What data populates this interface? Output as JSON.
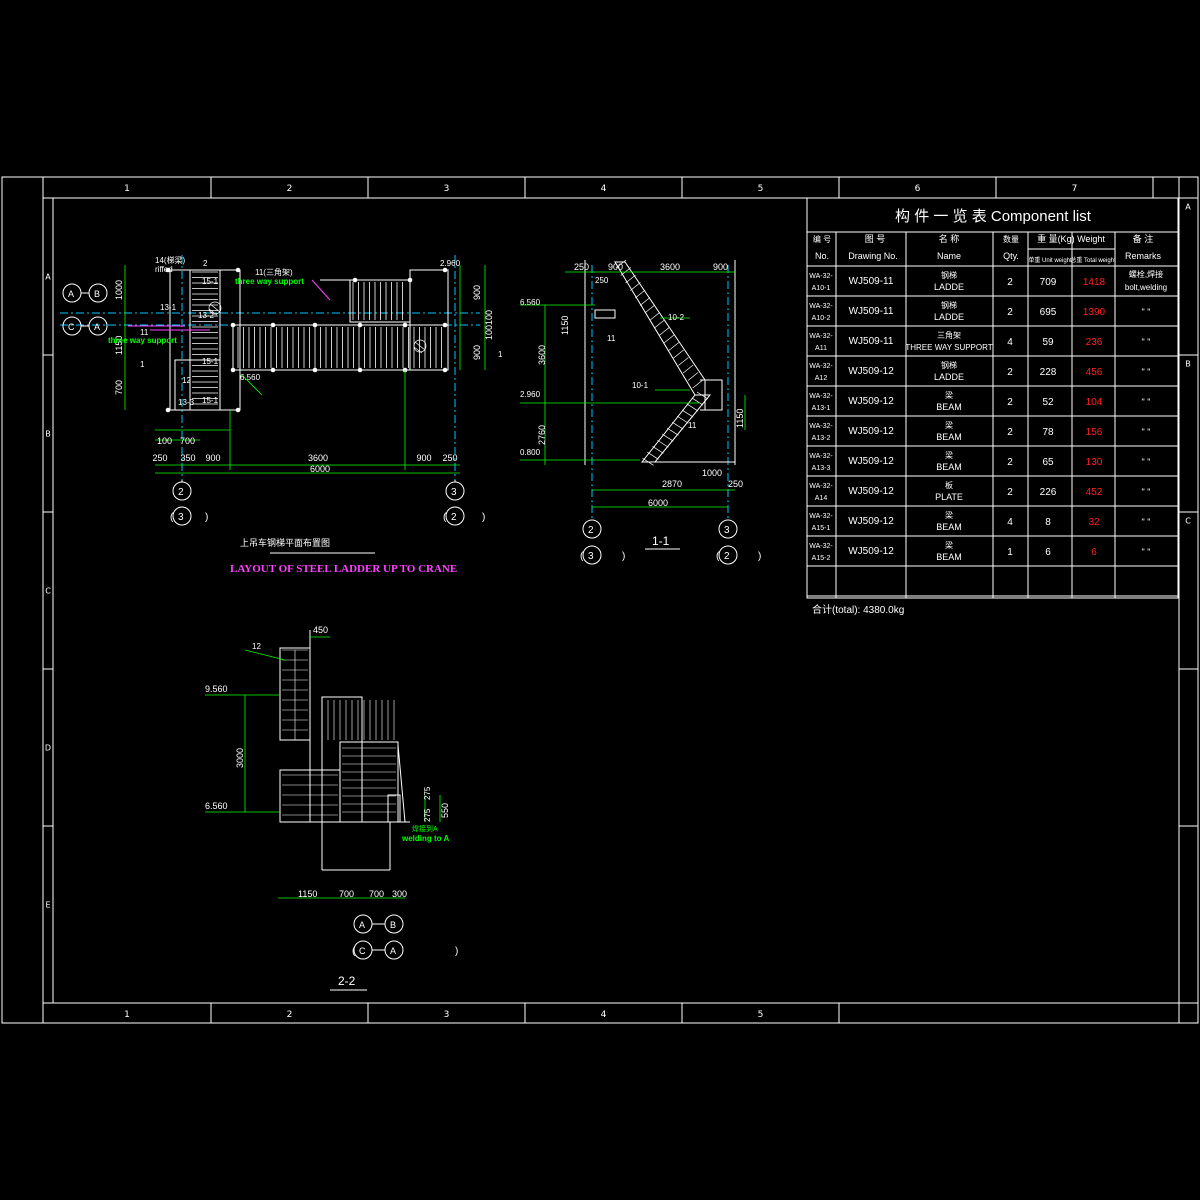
{
  "colors": {
    "background": "#000000",
    "frame": "#ffffff",
    "dimension": "#00ff00",
    "centerline": "#00c8ff",
    "steel": "#ffffff",
    "weight_total": "#ff2020",
    "title_en": "#ff40ff",
    "label_green": "#00ff00"
  },
  "grid_columns": [
    "1",
    "2",
    "3",
    "4",
    "5",
    "6",
    "7"
  ],
  "grid_columns_bottom": [
    "1",
    "2",
    "3",
    "4",
    "5"
  ],
  "grid_rows": [
    "A",
    "B",
    "C",
    "D",
    "E"
  ],
  "plan": {
    "title_cn": "上吊车钢梯平面布置图",
    "title_en": "LAYOUT OF STEEL LADDER UP TO CRANE",
    "grid_left": "2",
    "grid_right": "3",
    "ref_left": "3",
    "ref_right": "2",
    "dims_bottom_1": [
      "250",
      "350",
      "900",
      "3600",
      "900",
      "250"
    ],
    "dims_bottom_total": "6000",
    "dims_left": [
      "1000",
      "1150",
      "700"
    ],
    "dims_left_small": [
      "100",
      "700"
    ],
    "dims_right": [
      "900",
      "100",
      "100",
      "900"
    ],
    "axis_circles": [
      "A",
      "B",
      "C",
      "A"
    ],
    "labels": [
      "14(梯梁)",
      "riffed",
      "15-1",
      "13-1",
      "13-2",
      "15-1",
      "15-1",
      "13-3",
      "12",
      "11(三角架)",
      "three way support",
      "three way support",
      "2",
      "11",
      "1",
      "1",
      "6.560",
      "2.960"
    ]
  },
  "section_1_1": {
    "title": "1-1",
    "grid_left": "2",
    "grid_right": "3",
    "ref_left": "3",
    "ref_right": "2",
    "dims_top": [
      "250",
      "900",
      "3600",
      "900"
    ],
    "dims_top_small": "250",
    "dims_left": [
      "1150",
      "3600",
      "2760"
    ],
    "levels": [
      "6.560",
      "2.960",
      "0.800"
    ],
    "dims_bottom": [
      "2870",
      "250",
      "1000"
    ],
    "dims_bottom_total": "6000",
    "dim_right": "1150",
    "labels": [
      "10-2",
      "11",
      "10-1",
      "11"
    ]
  },
  "section_2_2": {
    "title": "2-2",
    "dims_top": "450",
    "levels": [
      "9.560",
      "6.560"
    ],
    "dim_left": "3000",
    "dims_right": [
      "275",
      "275",
      "550"
    ],
    "dims_bottom": [
      "1150",
      "700",
      "700",
      "300"
    ],
    "label_12": "12",
    "label_cn": "焊接到A",
    "label_en": "welding to A",
    "axis_top": [
      "A",
      "B"
    ],
    "axis_bottom": [
      "C",
      "A"
    ]
  },
  "component_list": {
    "title": "构 件 一 览 表  Component list",
    "headers": {
      "no_cn": "编 号",
      "no_en": "No.",
      "dwg_cn": "图 号",
      "dwg_en": "Drawing No.",
      "name_cn": "名 称",
      "name_en": "Name",
      "qty_cn": "数量",
      "qty_en": "Qty.",
      "weight": "重 量(Kg)  Weight",
      "unit_weight": "单重 Unit weight",
      "total_weight": "总重 Total weight",
      "remarks_cn": "备 注",
      "remarks_en": "Remarks"
    },
    "rows": [
      {
        "no": "WA-32-A10-1",
        "dwg": "WJ509-11",
        "name_cn": "钢梯",
        "name_en": "LADDE",
        "qty": "2",
        "unit": "709",
        "total": "1418",
        "remarks": "螺栓,焊接 bolt,welding"
      },
      {
        "no": "WA-32-A10-2",
        "dwg": "WJ509-11",
        "name_cn": "钢梯",
        "name_en": "LADDE",
        "qty": "2",
        "unit": "695",
        "total": "1390",
        "remarks": "\" \""
      },
      {
        "no": "WA-32-A11",
        "dwg": "WJ509-11",
        "name_cn": "三角架",
        "name_en": "THREE WAY SUPPORT",
        "qty": "4",
        "unit": "59",
        "total": "236",
        "remarks": "\" \""
      },
      {
        "no": "WA-32-A12",
        "dwg": "WJ509-12",
        "name_cn": "钢梯",
        "name_en": "LADDE",
        "qty": "2",
        "unit": "228",
        "total": "456",
        "remarks": "\" \""
      },
      {
        "no": "WA-32-A13-1",
        "dwg": "WJ509-12",
        "name_cn": "梁",
        "name_en": "BEAM",
        "qty": "2",
        "unit": "52",
        "total": "104",
        "remarks": "\" \""
      },
      {
        "no": "WA-32-A13-2",
        "dwg": "WJ509-12",
        "name_cn": "梁",
        "name_en": "BEAM",
        "qty": "2",
        "unit": "78",
        "total": "156",
        "remarks": "\" \""
      },
      {
        "no": "WA-32-A13-3",
        "dwg": "WJ509-12",
        "name_cn": "梁",
        "name_en": "BEAM",
        "qty": "2",
        "unit": "65",
        "total": "130",
        "remarks": "\" \""
      },
      {
        "no": "WA-32-A14",
        "dwg": "WJ509-12",
        "name_cn": "板",
        "name_en": "PLATE",
        "qty": "2",
        "unit": "226",
        "total": "452",
        "remarks": "\" \""
      },
      {
        "no": "WA-32-A15-1",
        "dwg": "WJ509-12",
        "name_cn": "梁",
        "name_en": "BEAM",
        "qty": "4",
        "unit": "8",
        "total": "32",
        "remarks": "\" \""
      },
      {
        "no": "WA-32-A15-2",
        "dwg": "WJ509-12",
        "name_cn": "梁",
        "name_en": "BEAM",
        "qty": "1",
        "unit": "6",
        "total": "6",
        "remarks": "\" \""
      }
    ],
    "total": "合计(total): 4380.0kg"
  }
}
